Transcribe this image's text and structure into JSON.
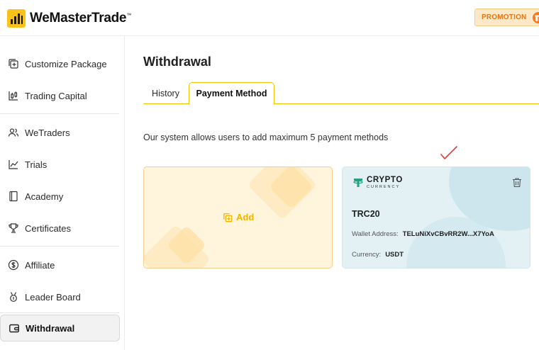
{
  "app": {
    "brand": "WeMasterTrade",
    "brand_tm": "™",
    "promotion_label": "PROMOTION"
  },
  "sidebar": {
    "items": [
      {
        "label": "Customize Package",
        "icon": "customize-icon"
      },
      {
        "label": "Trading Capital",
        "icon": "candlestick-icon"
      },
      {
        "label": "WeTraders",
        "icon": "users-icon"
      },
      {
        "label": "Trials",
        "icon": "line-chart-icon"
      },
      {
        "label": "Academy",
        "icon": "book-icon"
      },
      {
        "label": "Certificates",
        "icon": "trophy-icon"
      },
      {
        "label": "Affiliate",
        "icon": "dollar-icon"
      },
      {
        "label": "Leader Board",
        "icon": "medal-icon"
      },
      {
        "label": "Withdrawal",
        "icon": "wallet-icon",
        "active": true
      }
    ]
  },
  "main": {
    "title": "Withdrawal",
    "tabs": [
      {
        "label": "History",
        "active": false
      },
      {
        "label": "Payment Method",
        "active": true
      }
    ],
    "info_text": "Our system allows users to add maximum 5 payment methods",
    "add_card": {
      "label": "Add"
    },
    "payment_card": {
      "brand_top": "CRYPTO",
      "brand_bottom": "CURRENCY",
      "network": "TRC20",
      "wallet_label": "Wallet Address:",
      "wallet_value": "TELuNiXvCBvRR2W...X7YoA",
      "currency_label": "Currency:",
      "currency_value": "USDT"
    }
  },
  "colors": {
    "accent": "#f2c200",
    "promo_text": "#e2771a",
    "add_bg": "#fff4dc",
    "crypto_bg": "#e3f1f5",
    "check_mark": "#e53935"
  }
}
